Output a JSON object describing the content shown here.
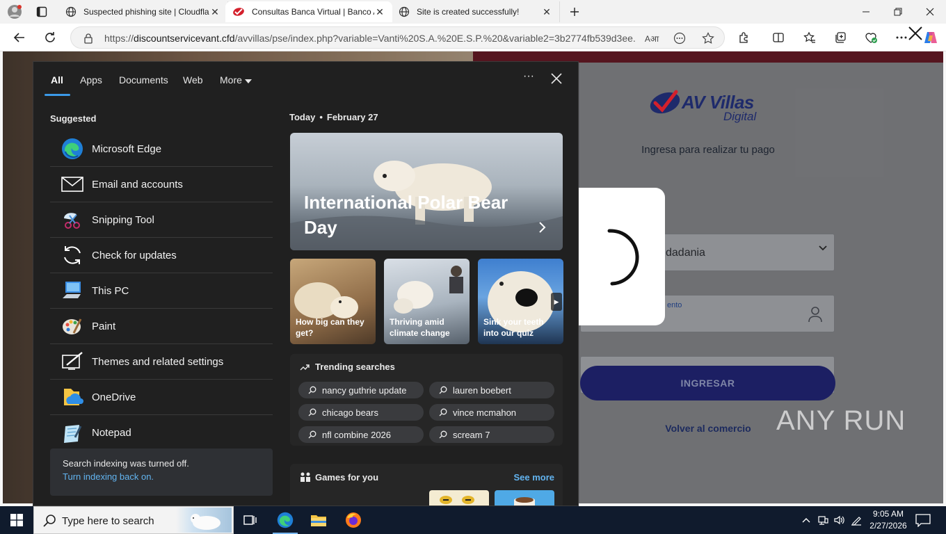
{
  "browser": {
    "tabs": [
      {
        "title": "Suspected phishing site | Cloudfla",
        "active": false
      },
      {
        "title": "Consultas Banca Virtual | Banco AV",
        "active": true
      },
      {
        "title": "Site is created successfully!",
        "active": false
      }
    ],
    "url_scheme": "https://",
    "url_host": "discountservicevant.cfd",
    "url_path": "/avvillas/pse/index.php?variable=Vanti%20S.A.%20E.S.P.%20&variable2=3b2774fb539d3ee...",
    "read_aloud_glyph": "Aआ"
  },
  "site": {
    "brand": "AV Villas",
    "brand_sub": "Digital",
    "subtitle": "Ingresa para realizar tu pago",
    "doc_type_value": "dadania",
    "doc_number_label": "ento",
    "password_value": "••••",
    "submit_label": "INGRESAR",
    "back_label": "Volver al comercio",
    "watermark": "ANY RUN"
  },
  "search_panel": {
    "tabs": [
      "All",
      "Apps",
      "Documents",
      "Web",
      "More"
    ],
    "more_options": "···",
    "suggested_title": "Suggested",
    "suggested": [
      {
        "label": "Microsoft Edge",
        "icon": "edge-icon"
      },
      {
        "label": "Email and accounts",
        "icon": "mail-icon"
      },
      {
        "label": "Snipping Tool",
        "icon": "snipping-tool-icon"
      },
      {
        "label": "Check for updates",
        "icon": "refresh-icon"
      },
      {
        "label": "This PC",
        "icon": "computer-icon"
      },
      {
        "label": "Paint",
        "icon": "paint-icon"
      },
      {
        "label": "Themes and related settings",
        "icon": "themes-icon"
      },
      {
        "label": "OneDrive",
        "icon": "onedrive-icon"
      },
      {
        "label": "Notepad",
        "icon": "notepad-icon"
      }
    ],
    "index_notice": "Search indexing was turned off.",
    "index_link": "Turn indexing back on.",
    "today_label": "Today",
    "today_sep": "•",
    "today_date": "February 27",
    "hero_title": "International Polar Bear Day",
    "cards": [
      {
        "label": "How big can they get?"
      },
      {
        "label": "Thriving amid climate change"
      },
      {
        "label": "Sink your teeth into our quiz"
      }
    ],
    "trending_title": "Trending searches",
    "trending": [
      "nancy guthrie update",
      "lauren boebert",
      "chicago bears",
      "vince mcmahon",
      "nfl combine 2026",
      "scream 7"
    ],
    "games_title": "Games for you",
    "games_more": "See more"
  },
  "taskbar": {
    "search_placeholder": "Type here to search",
    "time": "9:05 AM",
    "date": "2/27/2026"
  },
  "colors": {
    "accent": "#3b9ae8",
    "link": "#62b4f0",
    "panel_bg": "#202020",
    "taskbar_bg": "#101b2d",
    "brand_blue": "#1e2a6b",
    "brand_red": "#d4202c"
  }
}
